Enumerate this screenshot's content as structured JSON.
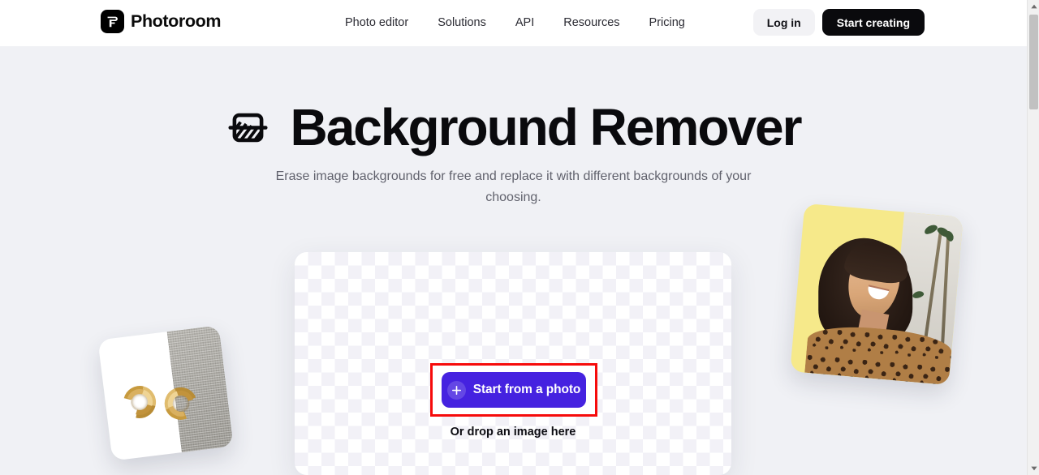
{
  "header": {
    "brand": {
      "name": "Photoroom",
      "icon": "photoroom-logo-icon"
    },
    "nav": [
      {
        "label": "Photo editor"
      },
      {
        "label": "Solutions"
      },
      {
        "label": "API"
      },
      {
        "label": "Resources"
      },
      {
        "label": "Pricing"
      }
    ],
    "login_label": "Log in",
    "start_label": "Start creating"
  },
  "hero": {
    "icon": "eraser-icon",
    "title": "Background Remover",
    "subtitle": "Erase image backgrounds for free and replace it with different backgrounds of your choosing."
  },
  "dropzone": {
    "cta_label": "Start from a photo",
    "cta_icon": "plus-icon",
    "hint": "Or drop an image here"
  },
  "colors": {
    "page_background": "#f0f1f5",
    "header_background": "#ffffff",
    "cta_purple": "#4522e0",
    "highlight_red": "#f60b0b",
    "start_button_black": "#0a0a0d",
    "login_button_grey": "#f2f2f5",
    "sample_yellow": "#f6e98a"
  },
  "samples": [
    {
      "name": "earrings-card",
      "description": "Gold hoop earrings on white and grey fabric background"
    },
    {
      "name": "portrait-card",
      "description": "Smiling woman on yellow and palm tree background"
    }
  ]
}
